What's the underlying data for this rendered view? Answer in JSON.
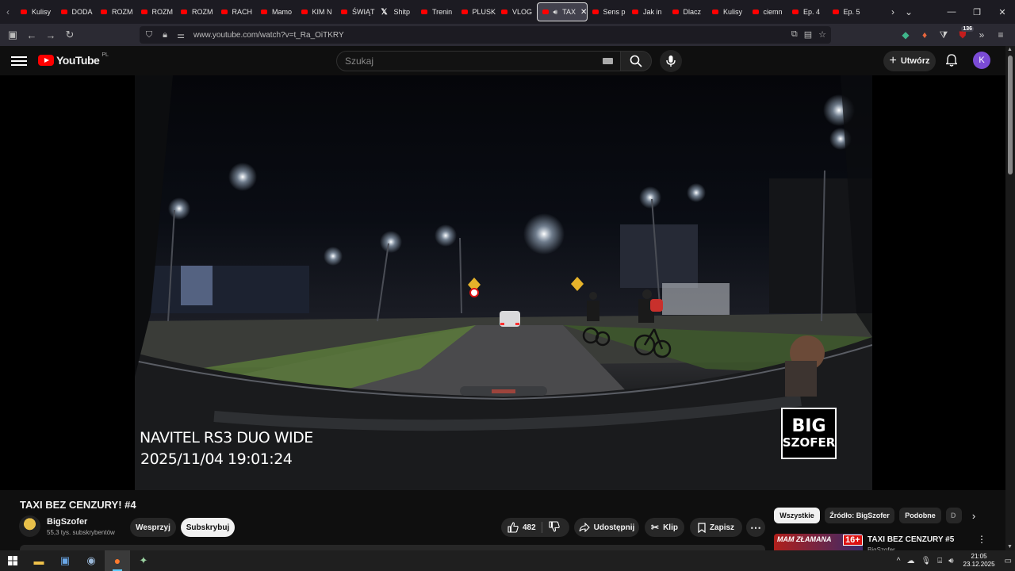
{
  "browser": {
    "tabs": [
      {
        "label": "Kulisy",
        "icon": "youtube"
      },
      {
        "label": "DODA",
        "icon": "youtube"
      },
      {
        "label": "ROZM",
        "icon": "youtube"
      },
      {
        "label": "ROZM",
        "icon": "youtube"
      },
      {
        "label": "ROZM",
        "icon": "youtube"
      },
      {
        "label": "RACH",
        "icon": "youtube"
      },
      {
        "label": "Mamo",
        "icon": "youtube"
      },
      {
        "label": "KIM N",
        "icon": "youtube"
      },
      {
        "label": "ŚWIĄT",
        "icon": "youtube"
      },
      {
        "label": "Shitp",
        "icon": "x"
      },
      {
        "label": "Trenin",
        "icon": "youtube"
      },
      {
        "label": "PLUSK",
        "icon": "youtube"
      },
      {
        "label": "VLOG",
        "icon": "youtube"
      },
      {
        "label": "TAX",
        "icon": "youtube",
        "active": true
      },
      {
        "label": "Sens p",
        "icon": "youtube"
      },
      {
        "label": "Jak in",
        "icon": "youtube"
      },
      {
        "label": "Dlacz",
        "icon": "youtube"
      },
      {
        "label": "Kulisy",
        "icon": "youtube"
      },
      {
        "label": "ciemn",
        "icon": "youtube"
      },
      {
        "label": "Ep. 4",
        "icon": "youtube"
      },
      {
        "label": "Ep. 5",
        "icon": "youtube"
      }
    ],
    "url": "www.youtube.com/watch?v=t_Ra_OiTKRY",
    "extension_badge": "136"
  },
  "youtube": {
    "logo_text": "YouTube",
    "country": "PL",
    "search_placeholder": "Szukaj",
    "create_label": "Utwórz",
    "avatar_letter": "K"
  },
  "video": {
    "osd_line1": "NAVITEL RS3 DUO WIDE",
    "osd_line2": "2025/11/04  19:01:24",
    "watermark_l1": "BIG",
    "watermark_l2": "SZOFER",
    "title": "TAXI BEZ CENZURY! #4",
    "channel": "BigSzofer",
    "subscribers": "55,3 tys. subskrybentów",
    "support_label": "Wesprzyj",
    "subscribe_label": "Subskrybuj",
    "likes": "482",
    "share_label": "Udostępnij",
    "clip_label": "Klip",
    "save_label": "Zapisz"
  },
  "sidebar": {
    "chips": [
      "Wszystkie",
      "Źródło: BigSzofer",
      "Podobne",
      "D"
    ],
    "rec": {
      "title": "TAXI BEZ CENZURY #5",
      "channel": "BigSzofer",
      "thumb_text": "MAM ZŁAMANA",
      "thumb_badge": "16+"
    }
  },
  "taskbar": {
    "time": "21:05",
    "date": "23.12.2025"
  }
}
